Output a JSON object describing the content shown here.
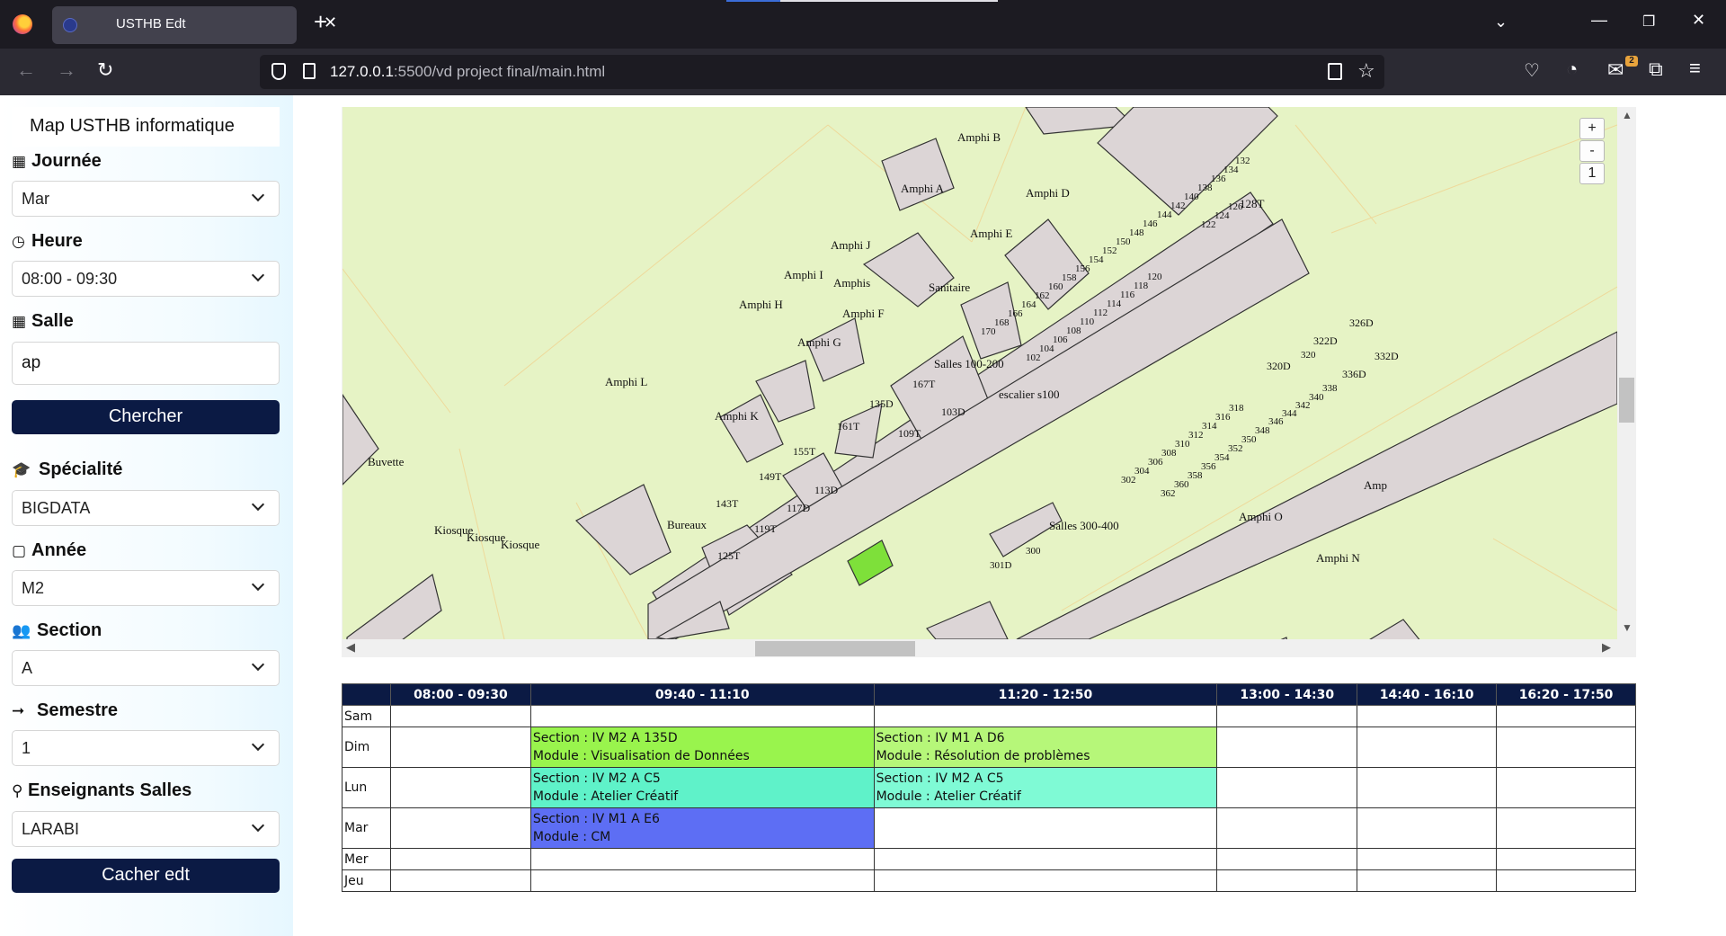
{
  "browser": {
    "tab_title": "USTHB Edt",
    "url_host": "127.0.0.1",
    "url_rest": ":5500/vd project final/main.html",
    "extension_badge": "2"
  },
  "sidebar": {
    "title": "Map USTHB informatique",
    "journee_label": "Journée",
    "journee_value": "Mar",
    "heure_label": "Heure",
    "heure_value": "08:00 - 09:30",
    "salle_label": "Salle",
    "salle_value": "ap",
    "search_button": "Chercher",
    "specialite_label": "Spécialité",
    "specialite_value": "BIGDATA",
    "annee_label": "Année",
    "annee_value": "M2",
    "section_label": "Section",
    "section_value": "A",
    "semestre_label": "Semestre",
    "semestre_value": "1",
    "enseignants_label": "Enseignants Salles",
    "enseignants_value": "LARABI",
    "hide_button": "Cacher edt"
  },
  "map": {
    "zoom_in": "+",
    "zoom_out": "-",
    "zoom_reset": "1",
    "highlight_color": "#7ee03a",
    "labels": {
      "amphi_b": "Amphi B",
      "amphi_a": "Amphi A",
      "amphi_d": "Amphi D",
      "amphi_e": "Amphi E",
      "amphi_j": "Amphi J",
      "amphi_i": "Amphi I",
      "amphis": "Amphis",
      "amphi_h": "Amphi H",
      "amphi_f": "Amphi F",
      "amphi_g": "Amphi G",
      "amphi_l": "Amphi L",
      "amphi_k": "Amphi K",
      "amphi_o": "Amphi O",
      "amphi_n": "Amphi N",
      "amp": "Amp",
      "sanitaire": "Sanitaire",
      "salles_100_200": "Salles 100-200",
      "salles_300_400": "Salles 300-400",
      "escalier": "escalier s100",
      "buvette": "Buvette",
      "bureaux": "Bureaux",
      "kiosque1": "Kiosque",
      "kiosque2": "Kiosque",
      "kiosque3": "Kiosque",
      "r128t": "128T",
      "r132": "132",
      "r134": "134",
      "r136": "136",
      "r138": "138",
      "r140": "140",
      "r142": "142",
      "r144": "144",
      "r146": "146",
      "r148": "148",
      "r150": "150",
      "r152": "152",
      "r154": "154",
      "r156": "156",
      "r158": "158",
      "r160": "160",
      "r162": "162",
      "r164": "164",
      "r166": "166",
      "r168": "168",
      "r170": "170",
      "r122": "122",
      "r124": "124",
      "r126": "126",
      "r120": "120",
      "r118": "118",
      "r116": "116",
      "r114": "114",
      "r112": "112",
      "r110": "110",
      "r108": "108",
      "r106": "106",
      "r104": "104",
      "r102": "102",
      "r167t": "167T",
      "r135d": "135D",
      "r161t": "161T",
      "r155t": "155T",
      "r149t": "149T",
      "r143t": "143T",
      "r103d": "103D",
      "r109t": "109T",
      "r113d": "113D",
      "r117d": "117D",
      "r119t": "119T",
      "r125t": "125T",
      "r326d": "326D",
      "r322d": "322D",
      "r332d": "332D",
      "r320": "320",
      "r320d": "320D",
      "r336d": "336D",
      "r338": "338",
      "r340": "340",
      "r342": "342",
      "r344": "344",
      "r346": "346",
      "r348": "348",
      "r350": "350",
      "r352": "352",
      "r354": "354",
      "r356": "356",
      "r358": "358",
      "r360": "360",
      "r362": "362",
      "r318": "318",
      "r316": "316",
      "r314": "314",
      "r312": "312",
      "r310": "310",
      "r308": "308",
      "r306": "306",
      "r304": "304",
      "r302": "302",
      "r300": "300",
      "r301d": "301D"
    }
  },
  "timetable": {
    "headers": [
      "",
      "08:00 - 09:30",
      "09:40 - 11:10",
      "11:20 - 12:50",
      "13:00 - 14:30",
      "14:40 - 16:10",
      "16:20 - 17:50"
    ],
    "days": [
      "Sam",
      "Dim",
      "Lun",
      "Mar",
      "Mer",
      "Jeu"
    ],
    "cells": {
      "dim_0940_section": "Section : IV M2 A 135D",
      "dim_0940_module": "Module : Visualisation de Données",
      "dim_1120_section": "Section : IV M1 A D6",
      "dim_1120_module": "Module : Résolution de problèmes",
      "lun_0940_section": "Section : IV M2 A C5",
      "lun_0940_module": "Module : Atelier Créatif",
      "lun_1120_section": "Section : IV M2 A C5",
      "lun_1120_module": "Module : Atelier Créatif",
      "mar_0940_section": "Section : IV M1 A E6",
      "mar_0940_module": "Module : CM"
    },
    "colors": {
      "dim_0940": "#99f44d",
      "dim_1120": "#b6f779",
      "lun_0940": "#5ff2c9",
      "lun_1120": "#7ffad5",
      "mar_0940": "#5d6ef4"
    }
  }
}
